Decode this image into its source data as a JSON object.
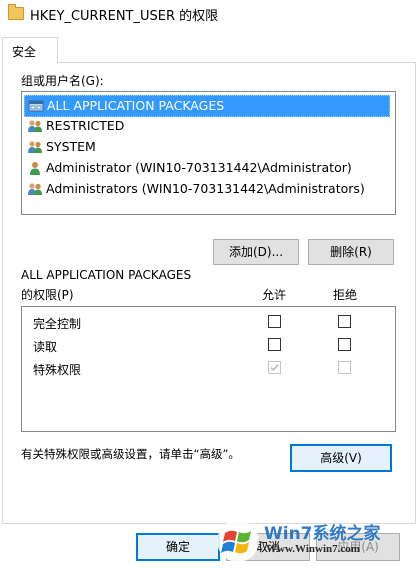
{
  "window": {
    "title": "HKEY_CURRENT_USER 的权限"
  },
  "tabs": [
    {
      "label": "安全"
    }
  ],
  "groups": {
    "label": "组或用户名(G):",
    "items": [
      {
        "label": "ALL APPLICATION PACKAGES",
        "icon": "app-packages-icon",
        "selected": true
      },
      {
        "label": "RESTRICTED",
        "icon": "users-group-icon",
        "selected": false
      },
      {
        "label": "SYSTEM",
        "icon": "users-group-icon",
        "selected": false
      },
      {
        "label": "Administrator (WIN10-703131442\\Administrator)",
        "icon": "user-icon",
        "selected": false
      },
      {
        "label": "Administrators (WIN10-703131442\\Administrators)",
        "icon": "users-group-icon",
        "selected": false
      }
    ]
  },
  "buttons": {
    "add": "添加(D)...",
    "remove": "删除(R)",
    "advanced": "高级(V)",
    "ok": "确定",
    "cancel": "取消",
    "apply": "应用(A)"
  },
  "permissions": {
    "heading_line1": "ALL APPLICATION PACKAGES",
    "heading_line2": "的权限(P)",
    "allow_label": "允许",
    "deny_label": "拒绝",
    "rows": [
      {
        "label": "完全控制",
        "allow": false,
        "deny": false,
        "disabled": false
      },
      {
        "label": "读取",
        "allow": false,
        "deny": false,
        "disabled": false
      },
      {
        "label": "特殊权限",
        "allow": true,
        "deny": false,
        "disabled": true
      }
    ]
  },
  "advanced_note": "有关特殊权限或高级设置，请单击“高级”。",
  "watermark": {
    "brand": "Win7系统之家",
    "url": "Www.Winwin7.com"
  },
  "colors": {
    "selection": "#3399ff",
    "accent": "#0078d7",
    "button_bg": "#e1e1e1"
  }
}
